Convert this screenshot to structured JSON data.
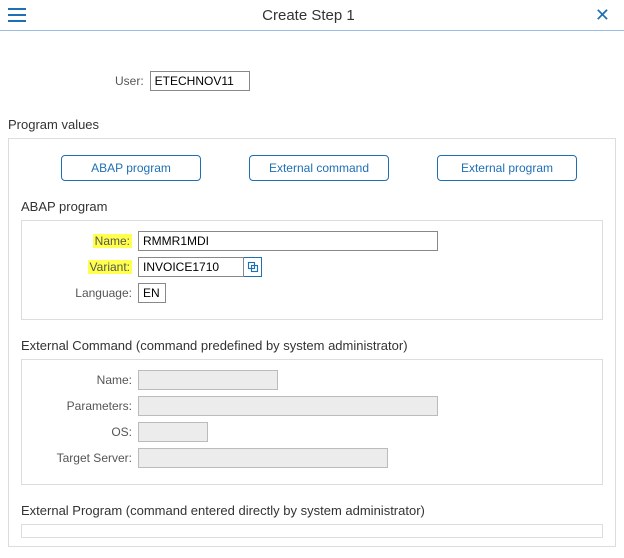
{
  "header": {
    "title": "Create Step 1"
  },
  "user": {
    "label": "User:",
    "value": "ETECHNOV11"
  },
  "section_heading": "Program values",
  "buttons": {
    "abap": "ABAP program",
    "ext_cmd": "External command",
    "ext_prog": "External program"
  },
  "abap": {
    "heading": "ABAP program",
    "name_label": "Name:",
    "name_value": "RMMR1MDI",
    "variant_label": "Variant:",
    "variant_value": "INVOICE1710",
    "language_label": "Language:",
    "language_value": "EN"
  },
  "extcmd": {
    "heading": "External Command (command predefined by system administrator)",
    "name_label": "Name:",
    "name_value": "",
    "params_label": "Parameters:",
    "params_value": "",
    "os_label": "OS:",
    "os_value": "",
    "target_label": "Target Server:",
    "target_value": ""
  },
  "extprog": {
    "heading": "External Program (command entered directly by system administrator)"
  }
}
